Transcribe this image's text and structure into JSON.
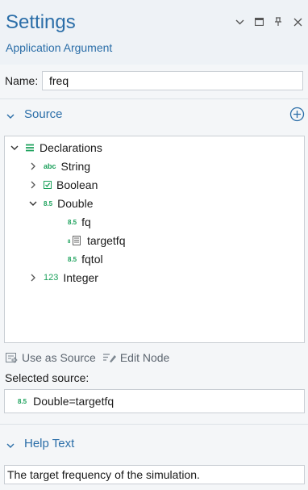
{
  "header": {
    "title": "Settings",
    "subtitle": "Application Argument"
  },
  "name": {
    "label": "Name:",
    "value": "freq"
  },
  "source": {
    "label": "Source",
    "tree": [
      {
        "label": "Declarations",
        "icon": "declarations-icon",
        "expanded": true
      },
      {
        "label": "String",
        "icon": "abc",
        "expanded": false
      },
      {
        "label": "Boolean",
        "icon": "checkbox-icon",
        "expanded": false
      },
      {
        "label": "Double",
        "icon": "8.5",
        "expanded": true
      },
      {
        "label": "fq",
        "icon": "8.5"
      },
      {
        "label": "targetfq",
        "icon": "8.5-table-icon"
      },
      {
        "label": "fqtol",
        "icon": "8.5"
      },
      {
        "label": "Integer",
        "icon": "123",
        "expanded": false
      }
    ],
    "use_as_source_label": "Use as Source",
    "edit_node_label": "Edit Node",
    "selected_label": "Selected source:",
    "selected_value": "Double=targetfq",
    "selected_icon": "8.5"
  },
  "help": {
    "label": "Help Text",
    "value": "The target frequency of the simulation."
  },
  "colors": {
    "accent": "#2b6ea8",
    "icon_green": "#1aa05a"
  }
}
